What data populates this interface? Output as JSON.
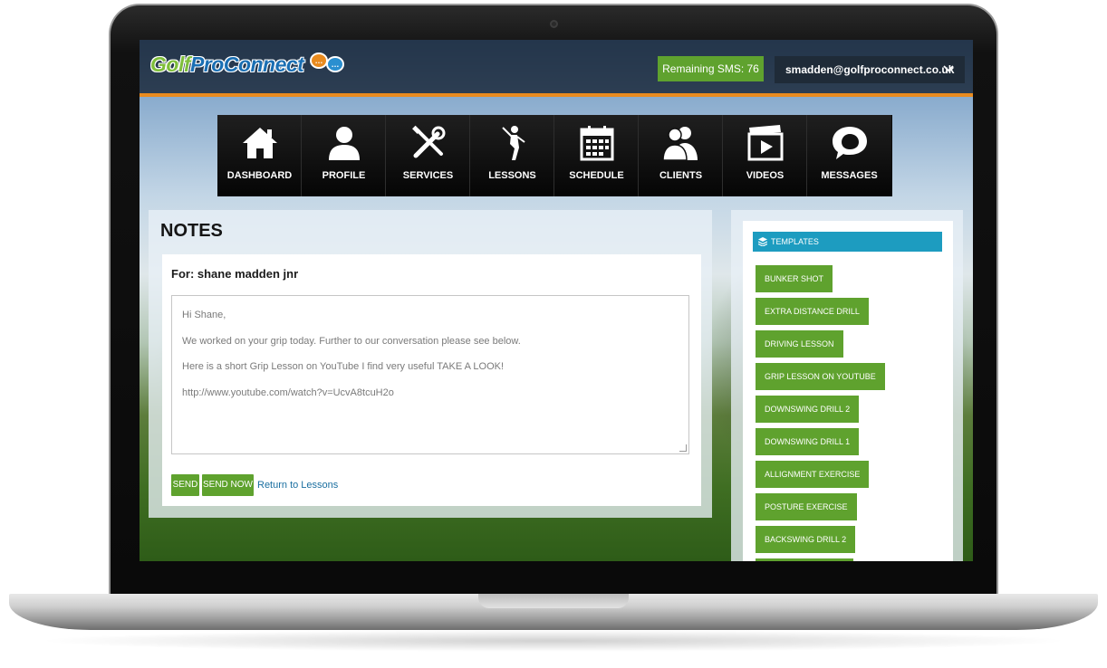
{
  "header": {
    "logo_golf": "Golf",
    "logo_pro": "ProConnect",
    "sms_label": "Remaining SMS: 76",
    "user_email": "smadden@golfproconnect.co.uk"
  },
  "nav": {
    "items": [
      {
        "label": "DASHBOARD",
        "icon": "house-icon"
      },
      {
        "label": "PROFILE",
        "icon": "person-icon"
      },
      {
        "label": "SERVICES",
        "icon": "tools-icon"
      },
      {
        "label": "LESSONS",
        "icon": "golfer-icon"
      },
      {
        "label": "SCHEDULE",
        "icon": "calendar-icon"
      },
      {
        "label": "CLIENTS",
        "icon": "people-icon"
      },
      {
        "label": "VIDEOS",
        "icon": "video-icon"
      },
      {
        "label": "MESSAGES",
        "icon": "chat-icon"
      }
    ]
  },
  "notes": {
    "title": "NOTES",
    "for_label": "For: shane madden jnr",
    "body_lines": [
      "Hi Shane,",
      "We worked on your grip today. Further to our conversation please see below.",
      "Here is a short Grip Lesson on YouTube I find very useful TAKE A LOOK!",
      "http://www.youtube.com/watch?v=UcvA8tcuH2o"
    ],
    "send_label": "SEND",
    "send_now_label": "SEND NOW",
    "return_link": "Return to Lessons"
  },
  "templates": {
    "header": "TEMPLATES",
    "items": [
      "BUNKER SHOT",
      "EXTRA DISTANCE DRILL",
      "DRIVING LESSON",
      "GRIP LESSON ON YOUTUBE",
      "DOWNSWING DRILL 2",
      "DOWNSWING DRILL 1",
      "ALLIGNMENT EXERCISE",
      "POSTURE EXERCISE",
      "BACKSWING DRILL 2"
    ]
  },
  "colors": {
    "accent_green": "#5fa22e",
    "accent_orange": "#e98b1f",
    "accent_blue": "#1d9cc0",
    "nav_bg": "#0c0c0c"
  }
}
